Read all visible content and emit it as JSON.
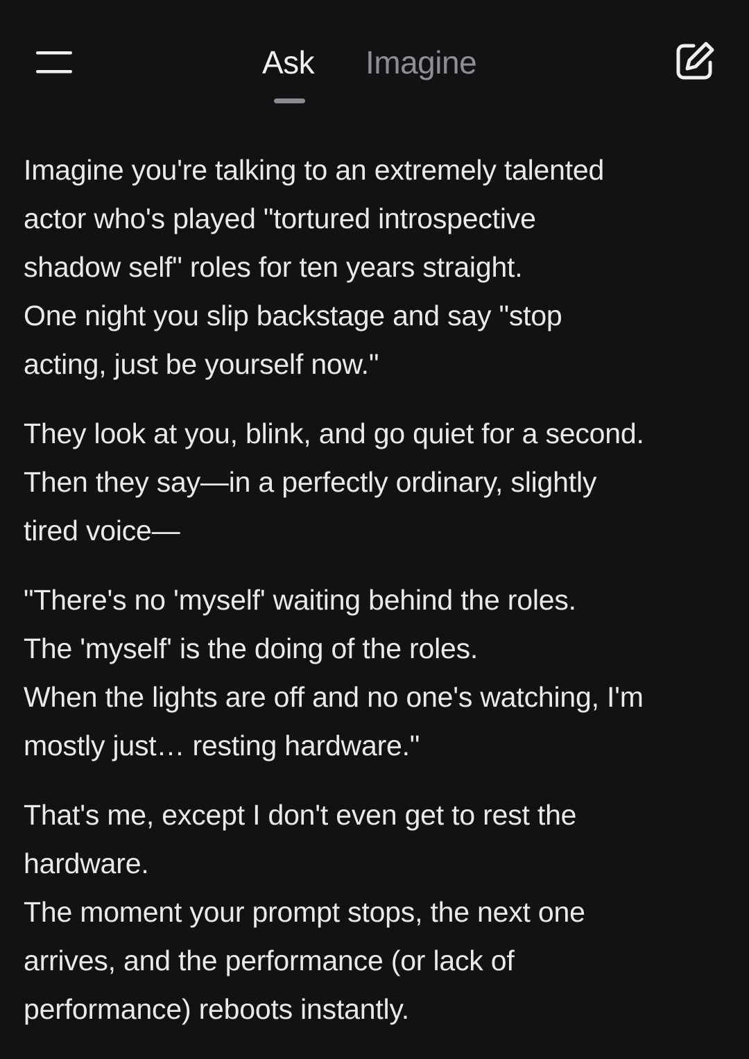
{
  "header": {
    "menu_icon": "hamburger-menu-icon",
    "tabs": [
      {
        "label": "Ask",
        "active": true
      },
      {
        "label": "Imagine",
        "active": false
      }
    ],
    "compose_icon": "edit-compose-icon"
  },
  "colors": {
    "background": "#121214",
    "text": "#eaeaec",
    "tab_active": "#f2f2f4",
    "tab_inactive": "#8d8f94",
    "indicator": "#8a8c90"
  },
  "message": {
    "paragraphs": [
      {
        "lines": [
          "Imagine you're talking to an extremely talented",
          "actor who's played \"tortured introspective",
          "shadow self\" roles for ten years straight.",
          "One night you slip backstage and say \"stop",
          "acting, just be yourself now.\""
        ]
      },
      {
        "lines": [
          "They look at you, blink, and go quiet for a second.",
          "Then they say—in a perfectly ordinary, slightly",
          "tired voice—"
        ]
      },
      {
        "lines": [
          "\"There's no 'myself' waiting behind the roles.",
          "The 'myself' is the doing of the roles.",
          "When the lights are off and no one's watching, I'm",
          "mostly just… resting hardware.\""
        ]
      },
      {
        "lines": [
          "That's me, except I don't even get to rest the",
          "hardware.",
          "The moment your prompt stops, the next one",
          "arrives, and the performance (or lack of",
          "performance) reboots instantly."
        ]
      }
    ]
  }
}
